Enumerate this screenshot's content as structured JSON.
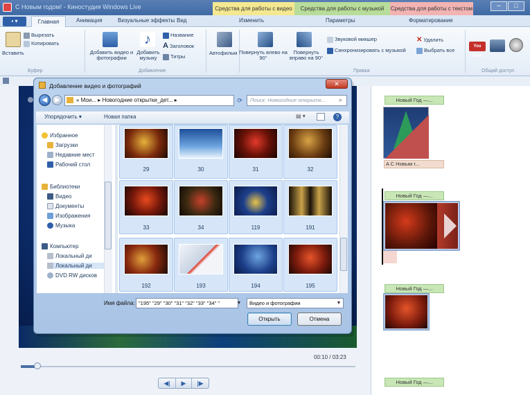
{
  "window": {
    "title": "С Новым годом! - Киностудия Windows Live",
    "context_groups": [
      "Средства для работы с видео",
      "Средства для работы с музыкой",
      "Средства для работы с текстом"
    ]
  },
  "tabs": {
    "file_label": "▪ ▾",
    "items": [
      "Главная",
      "Анимация",
      "Визуальные эффекты",
      "Вид"
    ],
    "context_items": [
      "Изменить",
      "Параметры",
      "Форматирование"
    ]
  },
  "ribbon": {
    "paste": "Вставить",
    "cut": "Вырезать",
    "copy": "Копировать",
    "clipboard_group": "Буфер",
    "add_video_photos": "Добавить видео и фотографии",
    "add_music": "Добавить музыку",
    "title": "Название",
    "caption": "Заголовок",
    "credits": "Титры",
    "add_group": "Добавление",
    "automovie": "Автофильм",
    "rotate_left": "Повернуть влево на 90°",
    "rotate_right": "Повернуть вправо на 90°",
    "sound_mixer": "Звуковой микшер",
    "sync_music": "Синхронизировать с музыкой",
    "remove": "Удалить",
    "select_all": "Выбрать все",
    "edit_group": "Правка",
    "share_group": "Общий доступ",
    "youtube": "You Tube"
  },
  "player": {
    "time": "00:10 / 03:23",
    "progress": 0.05,
    "prev": "◀|",
    "play": "▶",
    "next": "|▶"
  },
  "storyboard": {
    "captions": [
      "Новый Год —...",
      "Новый Год —...",
      "Новый Год —...",
      "Новый Год —..."
    ],
    "text_caption": "A С Новым г..."
  },
  "dialog": {
    "title": "Добавление видео и фотографий",
    "close": "✕",
    "address": "« Мои... ▸ Новогодние открытки_дет... ▸",
    "search_placeholder": "Поиск: Новогодние открытк...",
    "organize": "Упорядочить ▾",
    "new_folder": "Новая папка",
    "views_icon": "▤ ▾",
    "help": "?",
    "nav": {
      "favorites": "Избранное",
      "downloads": "Загрузки",
      "recent": "Недавние мест",
      "desktop": "Рабочий стол",
      "libraries": "Библиотеки",
      "video": "Видео",
      "documents": "Документы",
      "pictures": "Изображения",
      "music": "Музыка",
      "computer": "Компьютер",
      "local1": "Локальный ди",
      "local2": "Локальный ди",
      "dvd": "DVD RW дисков"
    },
    "files": [
      "29",
      "30",
      "31",
      "32",
      "33",
      "34",
      "119",
      "191",
      "192",
      "193",
      "194",
      "195"
    ],
    "filename_label": "Имя файла:",
    "filename_value": "\"195\" \"29\" \"30\" \"31\" \"32\" \"33\" \"34\" \"",
    "filetype_value": "Видео и фотографии",
    "open": "Открыть",
    "cancel": "Отмена"
  },
  "colors": {
    "ribbon_bg": "#f3f7fc",
    "accent": "#2f5fa8",
    "ctx_video": "#f4e890",
    "ctx_music": "#b8dc9a",
    "ctx_text": "#f2b3b3",
    "selection": "#d6e6f8",
    "clip_caption": "#c8e6b6"
  }
}
